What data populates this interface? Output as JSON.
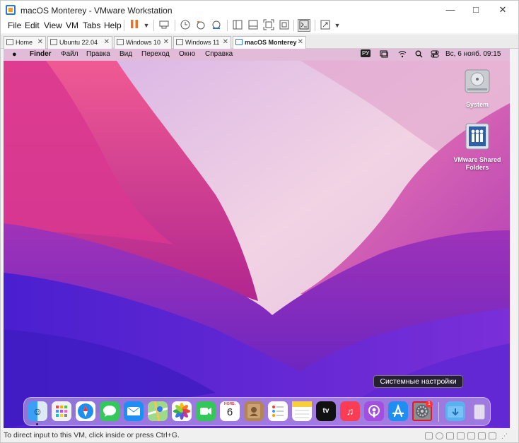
{
  "window": {
    "title": "macOS Monterey - VMware Workstation",
    "minimize": "—",
    "maximize": "□",
    "close": "✕"
  },
  "menu": [
    "File",
    "Edit",
    "View",
    "VM",
    "Tabs",
    "Help"
  ],
  "tabs": [
    {
      "label": "Home",
      "active": false
    },
    {
      "label": "Ubuntu 22.04",
      "active": false
    },
    {
      "label": "Windows 10",
      "active": false
    },
    {
      "label": "Windows 11",
      "active": false
    },
    {
      "label": "macOS Monterey",
      "active": true
    }
  ],
  "mac": {
    "apple": "",
    "menus": [
      "Finder",
      "Файл",
      "Правка",
      "Вид",
      "Переход",
      "Окно",
      "Справка"
    ],
    "input_source": "РУ",
    "datetime": "Вс, 6 нояб.  09:15"
  },
  "desktop": {
    "icons": [
      {
        "label": "System"
      },
      {
        "label": "VMware Shared Folders"
      }
    ]
  },
  "dock": {
    "tooltip": "Системные настройки",
    "calendar": {
      "month": "НОЯБ.",
      "day": "6"
    },
    "settings_badge": "1",
    "tv_label": "tv"
  },
  "status": {
    "text": "To direct input to this VM, click inside or press Ctrl+G."
  },
  "colors": {
    "accent": "#2f75d6",
    "pause": "#e8742a",
    "highlight": "#e01b1b"
  }
}
